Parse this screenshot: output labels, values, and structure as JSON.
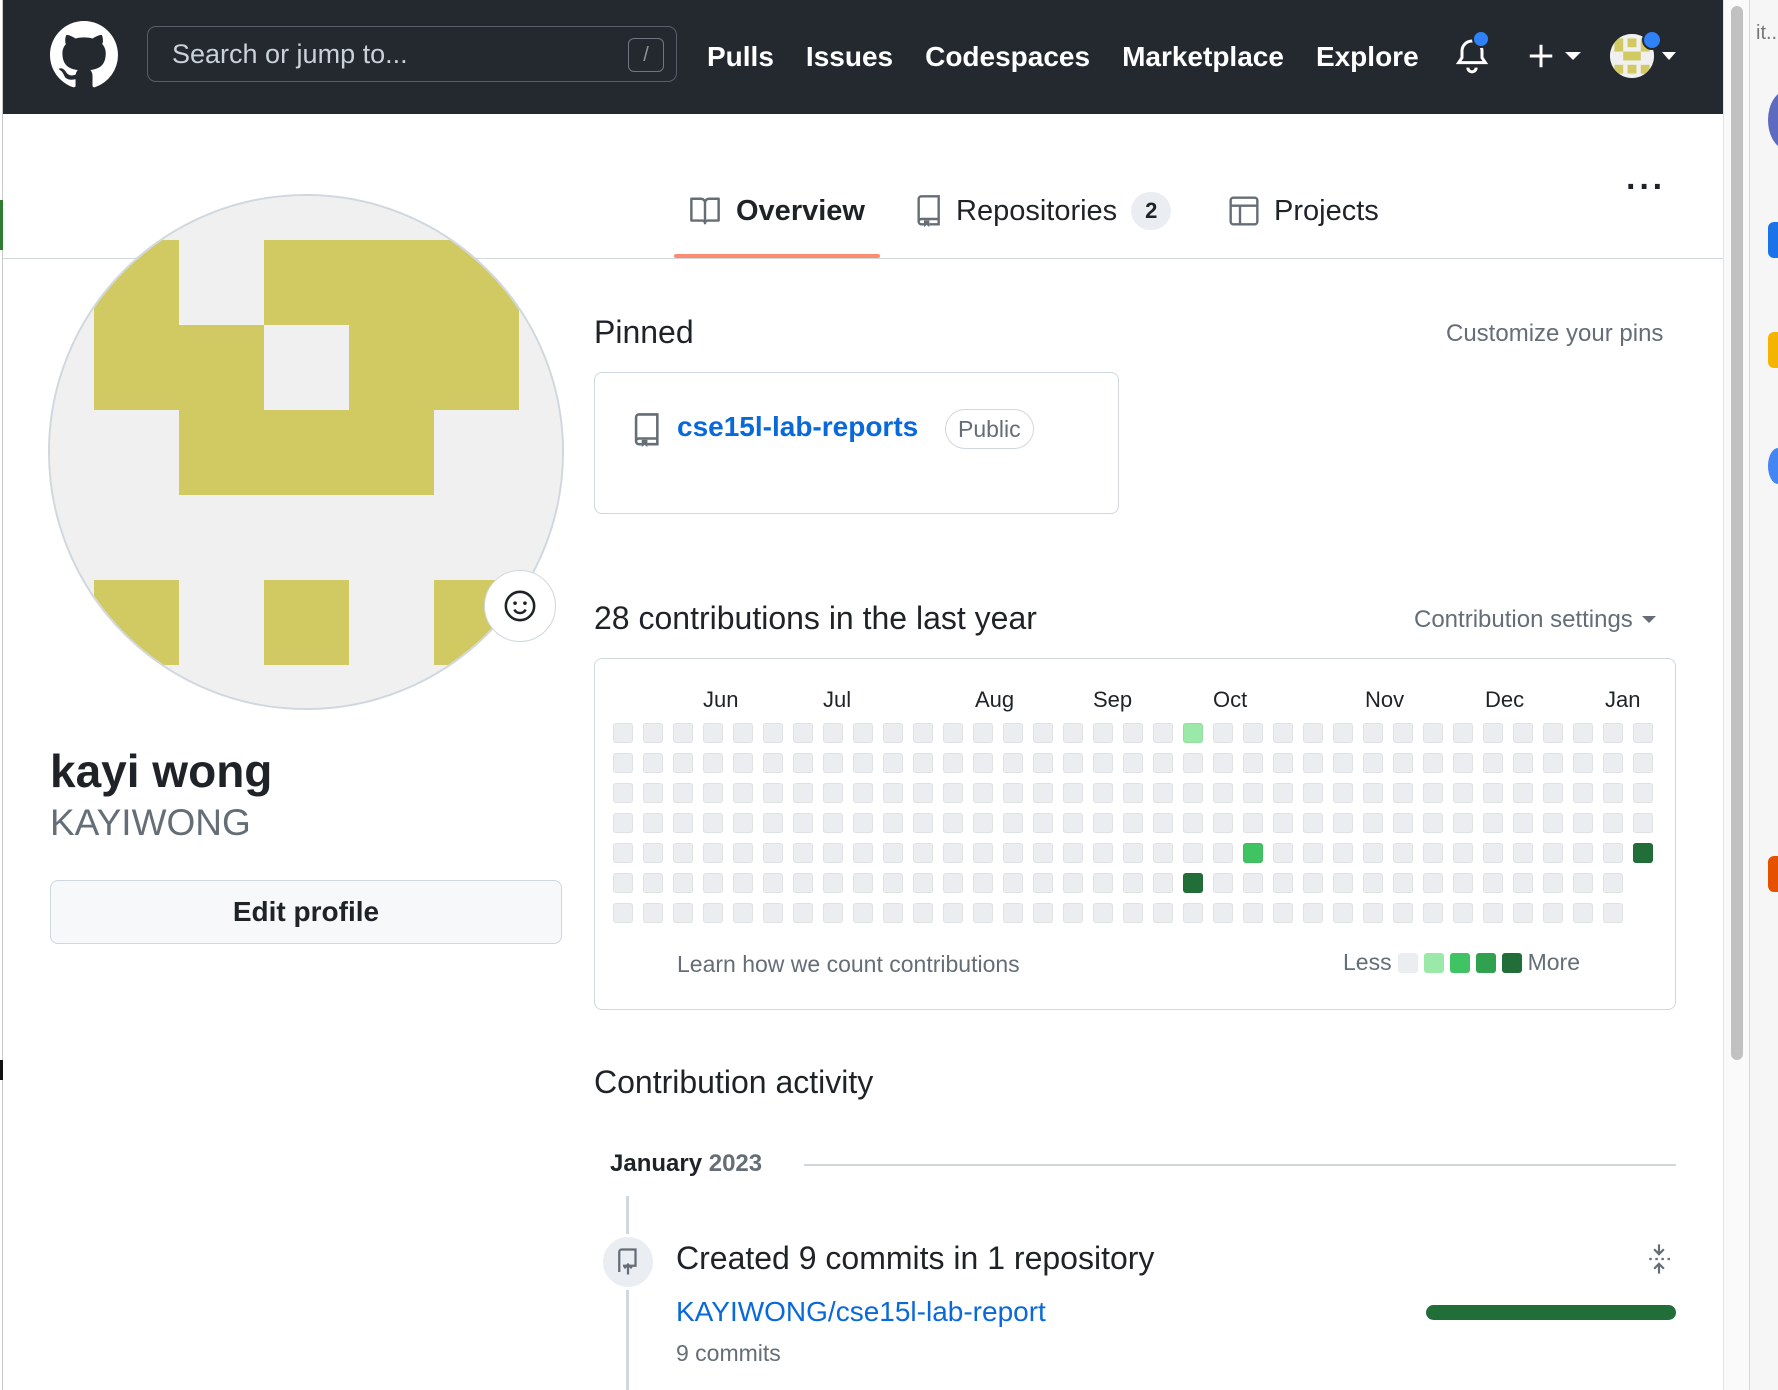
{
  "header": {
    "search_placeholder": "Search or jump to...",
    "search_shortcut": "/",
    "nav": [
      "Pulls",
      "Issues",
      "Codespaces",
      "Marketplace",
      "Explore"
    ]
  },
  "tabs": [
    {
      "label": "Overview",
      "active": true
    },
    {
      "label": "Repositories",
      "count": "2"
    },
    {
      "label": "Projects"
    }
  ],
  "profile": {
    "name": "kayi wong",
    "login": "KAYIWONG",
    "edit_label": "Edit profile"
  },
  "pinned": {
    "title": "Pinned",
    "customize": "Customize your pins",
    "repo": "cse15l-lab-reports",
    "visibility": "Public"
  },
  "contributions": {
    "title": "28 contributions in the last year",
    "settings": "Contribution settings",
    "months": [
      "Jun",
      "Jul",
      "Aug",
      "Sep",
      "Oct",
      "Nov",
      "Dec",
      "Jan"
    ],
    "learn": "Learn how we count contributions",
    "less": "Less",
    "more": "More",
    "colors": [
      "#ebedf0",
      "#9be9a8",
      "#40c463",
      "#30a14e",
      "#216e39"
    ]
  },
  "activity": {
    "title": "Contribution activity",
    "month": "January",
    "year": "2023",
    "summary": "Created 9 commits in 1 repository",
    "repo": "KAYIWONG/cse15l-lab-report",
    "commits": "9 commits"
  },
  "sidebar_fragment": {
    "text": "it..."
  }
}
